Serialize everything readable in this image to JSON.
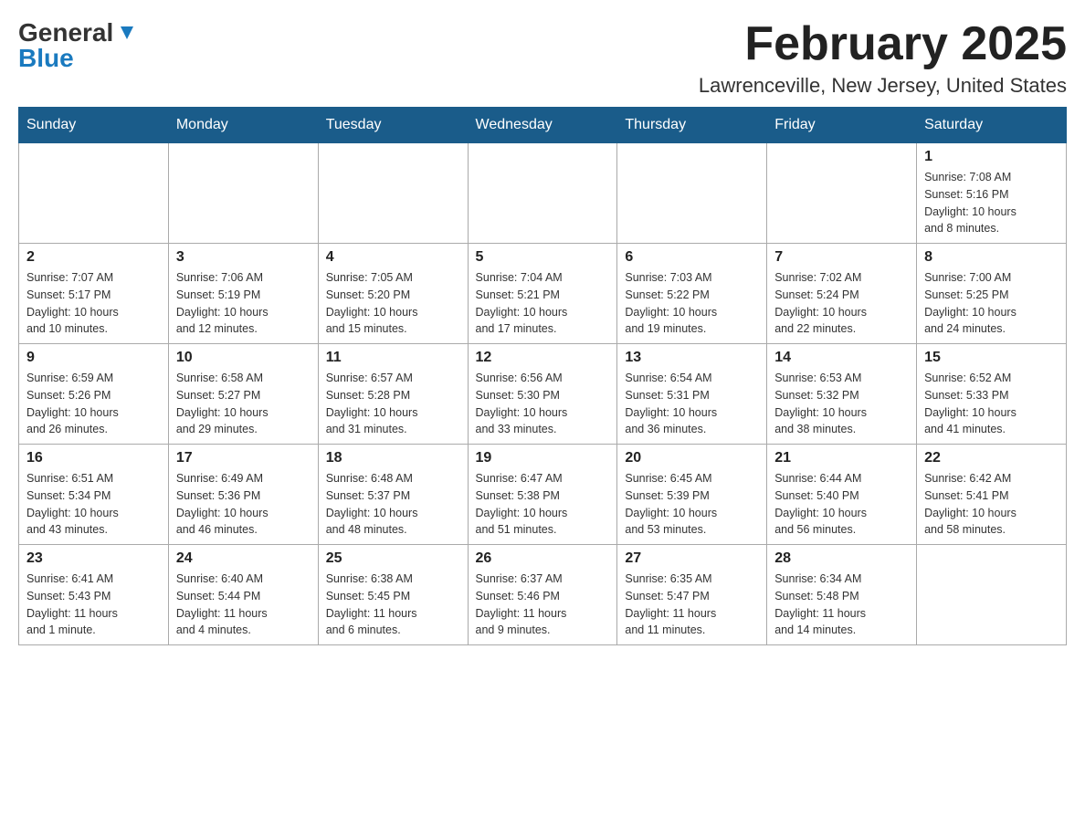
{
  "header": {
    "logo_general": "General",
    "logo_blue": "Blue",
    "month_title": "February 2025",
    "location": "Lawrenceville, New Jersey, United States"
  },
  "weekdays": [
    "Sunday",
    "Monday",
    "Tuesday",
    "Wednesday",
    "Thursday",
    "Friday",
    "Saturday"
  ],
  "weeks": [
    [
      {
        "day": "",
        "info": ""
      },
      {
        "day": "",
        "info": ""
      },
      {
        "day": "",
        "info": ""
      },
      {
        "day": "",
        "info": ""
      },
      {
        "day": "",
        "info": ""
      },
      {
        "day": "",
        "info": ""
      },
      {
        "day": "1",
        "info": "Sunrise: 7:08 AM\nSunset: 5:16 PM\nDaylight: 10 hours\nand 8 minutes."
      }
    ],
    [
      {
        "day": "2",
        "info": "Sunrise: 7:07 AM\nSunset: 5:17 PM\nDaylight: 10 hours\nand 10 minutes."
      },
      {
        "day": "3",
        "info": "Sunrise: 7:06 AM\nSunset: 5:19 PM\nDaylight: 10 hours\nand 12 minutes."
      },
      {
        "day": "4",
        "info": "Sunrise: 7:05 AM\nSunset: 5:20 PM\nDaylight: 10 hours\nand 15 minutes."
      },
      {
        "day": "5",
        "info": "Sunrise: 7:04 AM\nSunset: 5:21 PM\nDaylight: 10 hours\nand 17 minutes."
      },
      {
        "day": "6",
        "info": "Sunrise: 7:03 AM\nSunset: 5:22 PM\nDaylight: 10 hours\nand 19 minutes."
      },
      {
        "day": "7",
        "info": "Sunrise: 7:02 AM\nSunset: 5:24 PM\nDaylight: 10 hours\nand 22 minutes."
      },
      {
        "day": "8",
        "info": "Sunrise: 7:00 AM\nSunset: 5:25 PM\nDaylight: 10 hours\nand 24 minutes."
      }
    ],
    [
      {
        "day": "9",
        "info": "Sunrise: 6:59 AM\nSunset: 5:26 PM\nDaylight: 10 hours\nand 26 minutes."
      },
      {
        "day": "10",
        "info": "Sunrise: 6:58 AM\nSunset: 5:27 PM\nDaylight: 10 hours\nand 29 minutes."
      },
      {
        "day": "11",
        "info": "Sunrise: 6:57 AM\nSunset: 5:28 PM\nDaylight: 10 hours\nand 31 minutes."
      },
      {
        "day": "12",
        "info": "Sunrise: 6:56 AM\nSunset: 5:30 PM\nDaylight: 10 hours\nand 33 minutes."
      },
      {
        "day": "13",
        "info": "Sunrise: 6:54 AM\nSunset: 5:31 PM\nDaylight: 10 hours\nand 36 minutes."
      },
      {
        "day": "14",
        "info": "Sunrise: 6:53 AM\nSunset: 5:32 PM\nDaylight: 10 hours\nand 38 minutes."
      },
      {
        "day": "15",
        "info": "Sunrise: 6:52 AM\nSunset: 5:33 PM\nDaylight: 10 hours\nand 41 minutes."
      }
    ],
    [
      {
        "day": "16",
        "info": "Sunrise: 6:51 AM\nSunset: 5:34 PM\nDaylight: 10 hours\nand 43 minutes."
      },
      {
        "day": "17",
        "info": "Sunrise: 6:49 AM\nSunset: 5:36 PM\nDaylight: 10 hours\nand 46 minutes."
      },
      {
        "day": "18",
        "info": "Sunrise: 6:48 AM\nSunset: 5:37 PM\nDaylight: 10 hours\nand 48 minutes."
      },
      {
        "day": "19",
        "info": "Sunrise: 6:47 AM\nSunset: 5:38 PM\nDaylight: 10 hours\nand 51 minutes."
      },
      {
        "day": "20",
        "info": "Sunrise: 6:45 AM\nSunset: 5:39 PM\nDaylight: 10 hours\nand 53 minutes."
      },
      {
        "day": "21",
        "info": "Sunrise: 6:44 AM\nSunset: 5:40 PM\nDaylight: 10 hours\nand 56 minutes."
      },
      {
        "day": "22",
        "info": "Sunrise: 6:42 AM\nSunset: 5:41 PM\nDaylight: 10 hours\nand 58 minutes."
      }
    ],
    [
      {
        "day": "23",
        "info": "Sunrise: 6:41 AM\nSunset: 5:43 PM\nDaylight: 11 hours\nand 1 minute."
      },
      {
        "day": "24",
        "info": "Sunrise: 6:40 AM\nSunset: 5:44 PM\nDaylight: 11 hours\nand 4 minutes."
      },
      {
        "day": "25",
        "info": "Sunrise: 6:38 AM\nSunset: 5:45 PM\nDaylight: 11 hours\nand 6 minutes."
      },
      {
        "day": "26",
        "info": "Sunrise: 6:37 AM\nSunset: 5:46 PM\nDaylight: 11 hours\nand 9 minutes."
      },
      {
        "day": "27",
        "info": "Sunrise: 6:35 AM\nSunset: 5:47 PM\nDaylight: 11 hours\nand 11 minutes."
      },
      {
        "day": "28",
        "info": "Sunrise: 6:34 AM\nSunset: 5:48 PM\nDaylight: 11 hours\nand 14 minutes."
      },
      {
        "day": "",
        "info": ""
      }
    ]
  ]
}
